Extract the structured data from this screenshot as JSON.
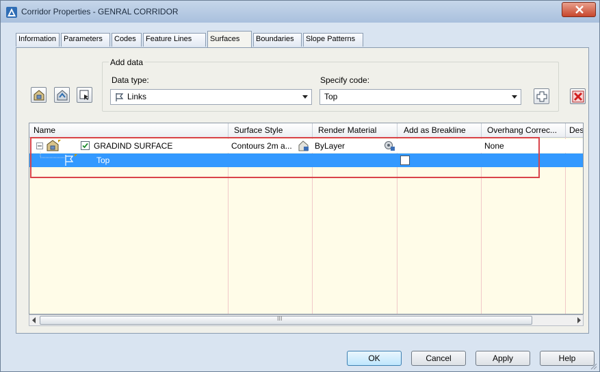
{
  "window": {
    "title": "Corridor Properties - GENRAL CORRIDOR",
    "close_label": "✕"
  },
  "tabs": [
    {
      "label": "Information"
    },
    {
      "label": "Parameters"
    },
    {
      "label": "Codes"
    },
    {
      "label": "Feature Lines"
    },
    {
      "label": "Surfaces"
    },
    {
      "label": "Boundaries"
    },
    {
      "label": "Slope Patterns"
    }
  ],
  "active_tab": "Surfaces",
  "add_data": {
    "group_title": "Add data",
    "data_type_label": "Data type:",
    "data_type_value": "Links",
    "specify_code_label": "Specify code:",
    "specify_code_value": "Top"
  },
  "grid": {
    "columns": [
      "Name",
      "Surface Style",
      "Render Material",
      "Add as Breakline",
      "Overhang Correc...",
      "Des"
    ],
    "rows": [
      {
        "name": "GRADIND SURFACE",
        "surface_style": "Contours 2m a...",
        "render_material": "ByLayer",
        "add_as_breakline": "",
        "overhang": "None",
        "checked": true
      },
      {
        "name": "Top",
        "surface_style": "",
        "render_material": "",
        "add_as_breakline": "",
        "overhang": ""
      }
    ],
    "scroll_grip": "III"
  },
  "buttons": {
    "ok": "OK",
    "cancel": "Cancel",
    "apply": "Apply",
    "help": "Help"
  },
  "colors": {
    "selected_row": "#3399ff",
    "highlight_border": "#d9434a",
    "grid_background": "#fffce8"
  }
}
